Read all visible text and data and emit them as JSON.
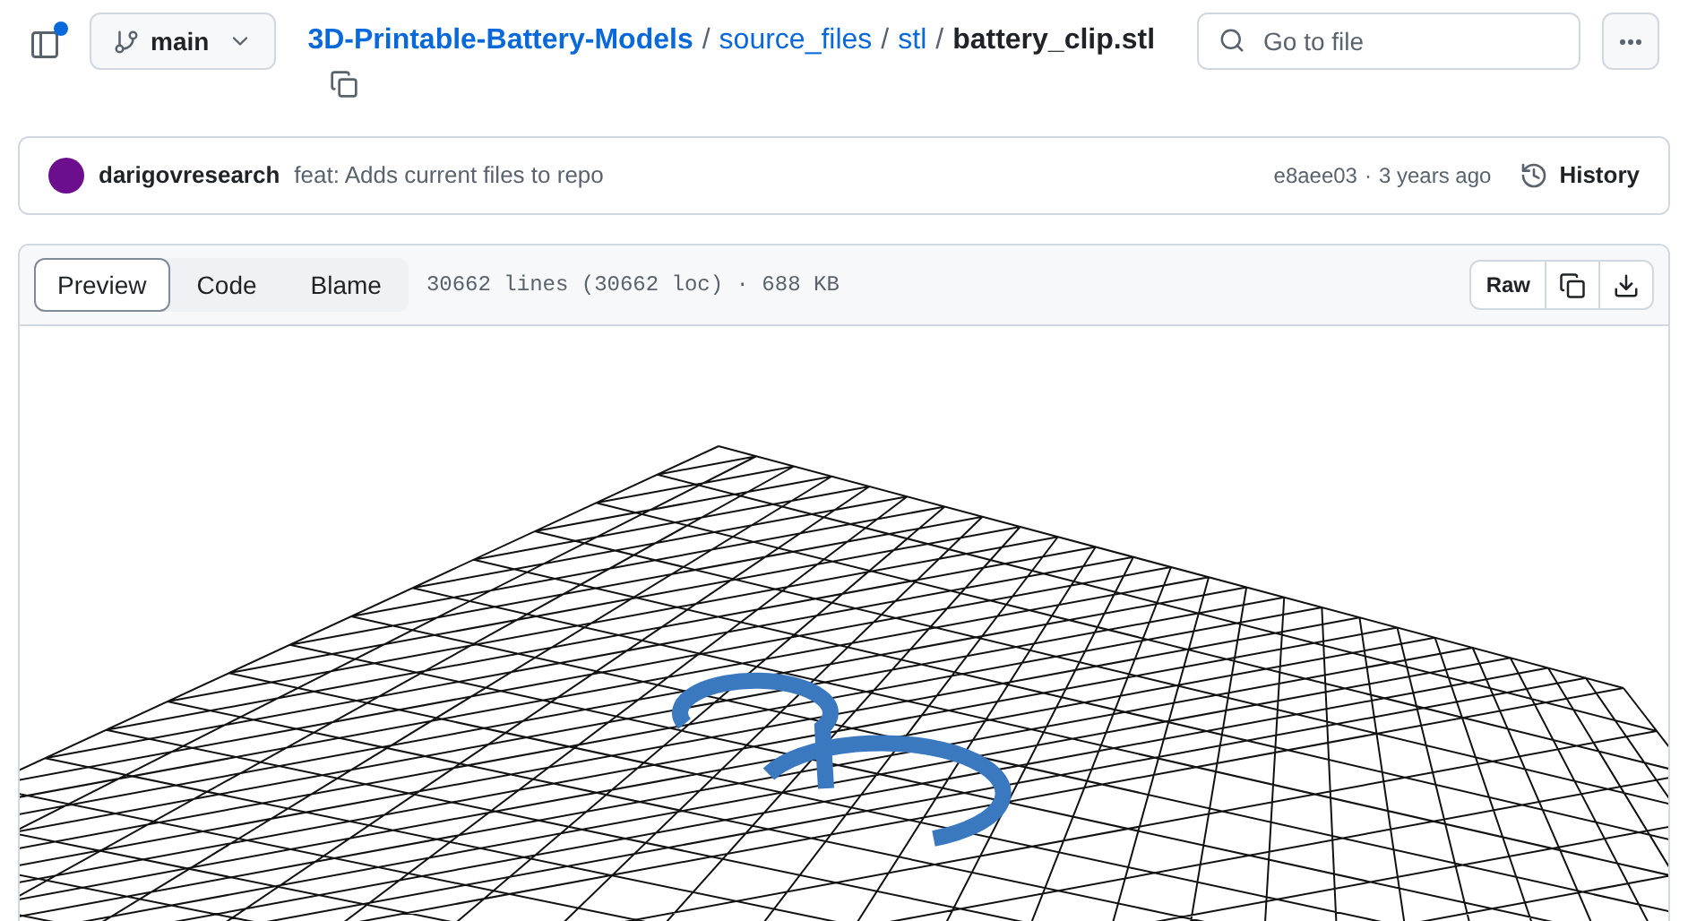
{
  "header": {
    "branch": "main",
    "breadcrumb": [
      {
        "label": "3D-Printable-Battery-Models",
        "kind": "repo"
      },
      {
        "separator": "/",
        "label": "source_files",
        "kind": "folder"
      },
      {
        "separator": "/",
        "label": "stl",
        "kind": "folder"
      },
      {
        "separator": "/",
        "label": "battery_clip.stl",
        "kind": "file"
      }
    ],
    "search": {
      "placeholder": "Go to file"
    }
  },
  "commit": {
    "author": "darigovresearch",
    "message": "feat: Adds current files to repo",
    "sha": "e8aee03",
    "separator": "·",
    "age": "3 years ago",
    "history": "History"
  },
  "file": {
    "tabs": [
      {
        "label": "Preview",
        "selected": true
      },
      {
        "label": "Code",
        "selected": false
      },
      {
        "label": "Blame",
        "selected": false
      }
    ],
    "info": "30662 lines (30662 loc) · 688 KB",
    "raw": "Raw"
  }
}
